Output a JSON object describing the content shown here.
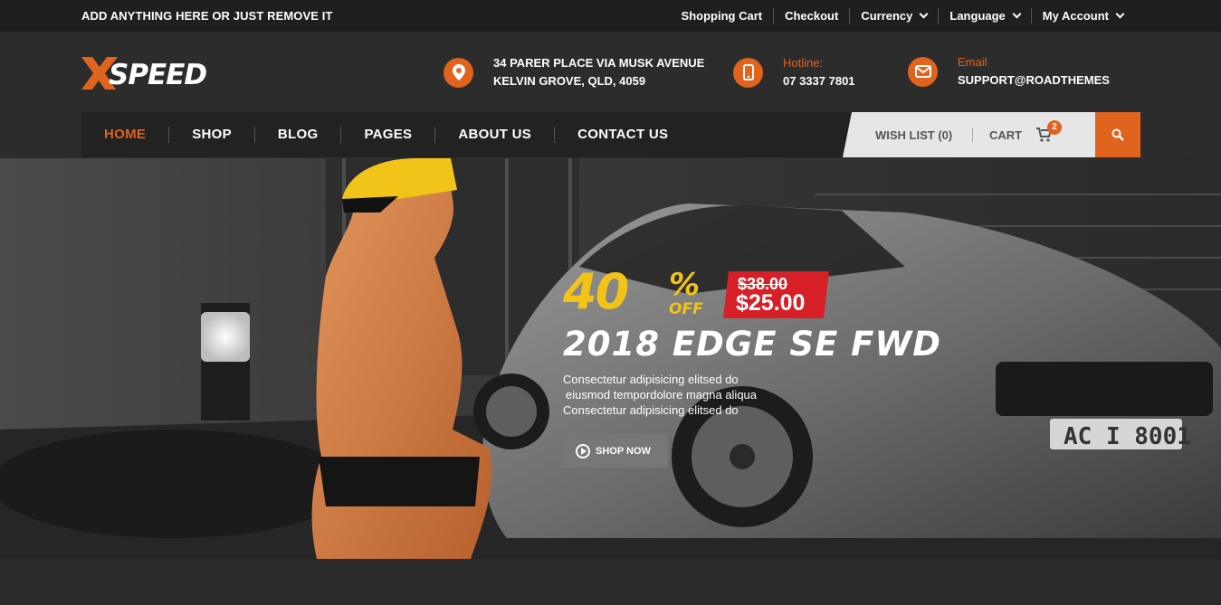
{
  "topbar": {
    "message": "ADD ANYTHING HERE OR JUST REMOVE IT",
    "links": [
      {
        "label": "Shopping Cart",
        "dropdown": false
      },
      {
        "label": "Checkout",
        "dropdown": false
      },
      {
        "label": "Currency",
        "dropdown": true
      },
      {
        "label": "Language",
        "dropdown": true
      },
      {
        "label": "My Account",
        "dropdown": true
      }
    ]
  },
  "header": {
    "logo_text": "XSPEED",
    "address": {
      "icon": "map-pin-icon",
      "line1": "34 PARER PLACE VIA MUSK AVENUE",
      "line2": "KELVIN GROVE, QLD, 4059"
    },
    "hotline": {
      "icon": "phone-icon",
      "label": "Hotline:",
      "value": "07 3337 7801"
    },
    "email": {
      "icon": "envelope-icon",
      "label": "Email",
      "value": "SUPPORT@ROADTHEMES"
    }
  },
  "nav": {
    "items": [
      "HOME",
      "SHOP",
      "BLOG",
      "PAGES",
      "ABOUT US",
      "CONTACT US"
    ],
    "active": "HOME",
    "wishlist": "WISH LIST (0)",
    "cart": "CART",
    "cart_count": "2",
    "search_icon": "search-icon"
  },
  "hero": {
    "discount_number": "40",
    "discount_percent": "%",
    "discount_off": "OFF",
    "old_price": "$38.00",
    "new_price": "$25.00",
    "title": "2018 EDGE SE FWD",
    "desc_lines": [
      "Consectetur adipisicing elitsed do",
      "eiusmod tempordolore magna aliqua",
      "Consectetur adipisicing elitsed do"
    ],
    "button": "SHOP NOW"
  },
  "colors": {
    "accent": "#e0631e",
    "price_red": "#d61f26",
    "discount_yellow": "#f2c318",
    "topbar_bg": "#1f1f1f",
    "header_bg": "#2c2c2c"
  }
}
